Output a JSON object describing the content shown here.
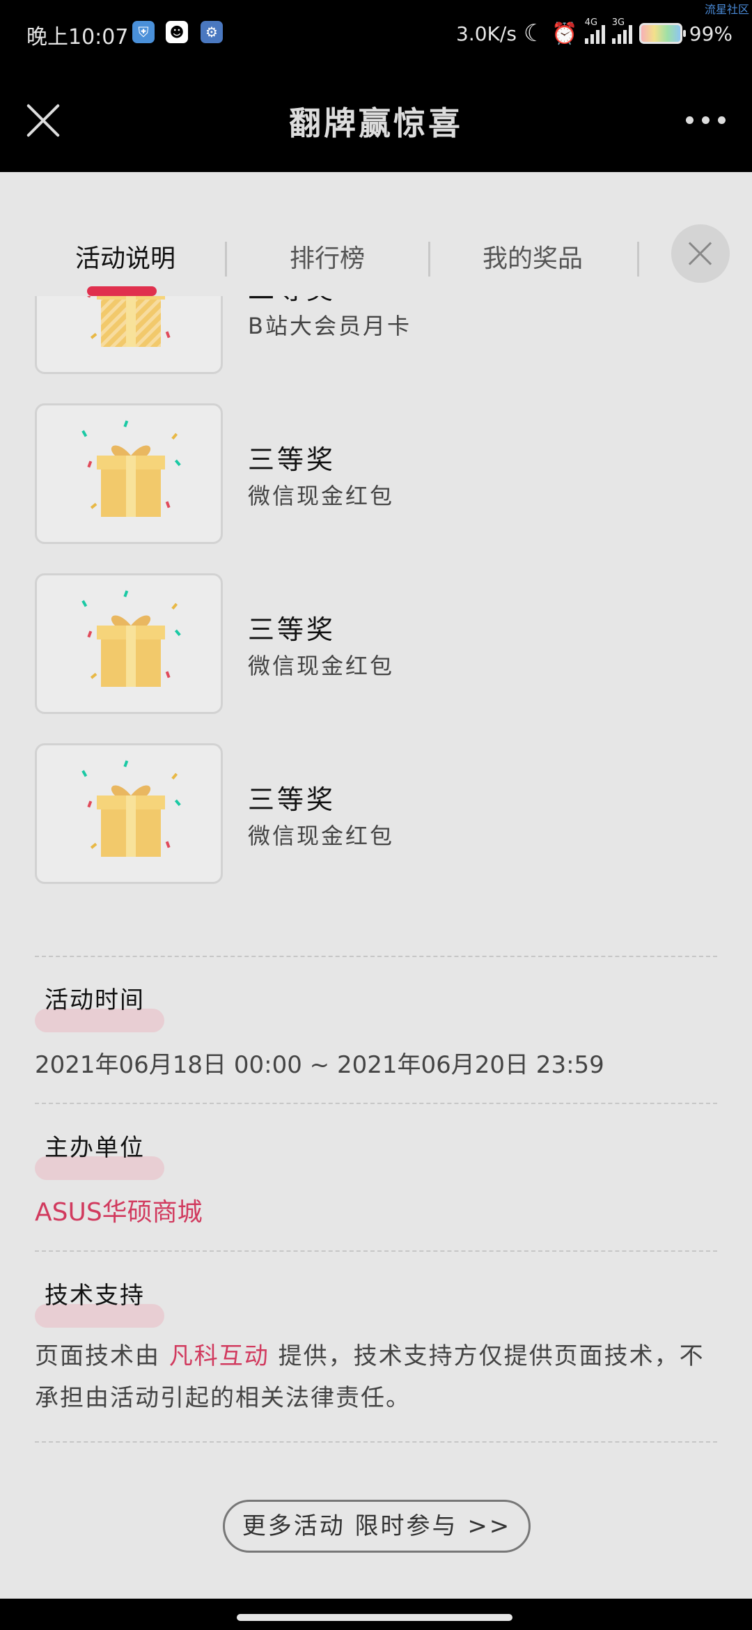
{
  "status_bar": {
    "time": "晚上10:07",
    "net_speed": "3.0K/s",
    "signal1_label": "4G",
    "signal2_label": "3G",
    "battery": "99%",
    "watermark": "流星社区"
  },
  "nav": {
    "title": "翻牌赢惊喜",
    "close_icon": "close-icon",
    "more_icon": "more-icon"
  },
  "tabs": [
    {
      "label": "活动说明",
      "active": true
    },
    {
      "label": "排行榜",
      "active": false
    },
    {
      "label": "我的奖品",
      "active": false
    }
  ],
  "prizes": [
    {
      "level": "二等奖",
      "name": "B站大会员月卡"
    },
    {
      "level": "三等奖",
      "name": "微信现金红包"
    },
    {
      "level": "三等奖",
      "name": "微信现金红包"
    },
    {
      "level": "三等奖",
      "name": "微信现金红包"
    }
  ],
  "sections": {
    "time": {
      "heading": "活动时间",
      "value": "2021年06月18日 00:00 ~ 2021年06月20日 23:59"
    },
    "organizer": {
      "heading": "主办单位",
      "value": "ASUS华硕商城"
    },
    "support": {
      "heading": "技术支持",
      "text_before": "页面技术由 ",
      "link": "凡科互动",
      "text_after": " 提供，技术支持方仅提供页面技术，不承担由活动引起的相关法律责任。"
    }
  },
  "more_button": "更多活动 限时参与 >>",
  "colors": {
    "accent": "#d13a5e",
    "background": "#e6e6e6"
  }
}
